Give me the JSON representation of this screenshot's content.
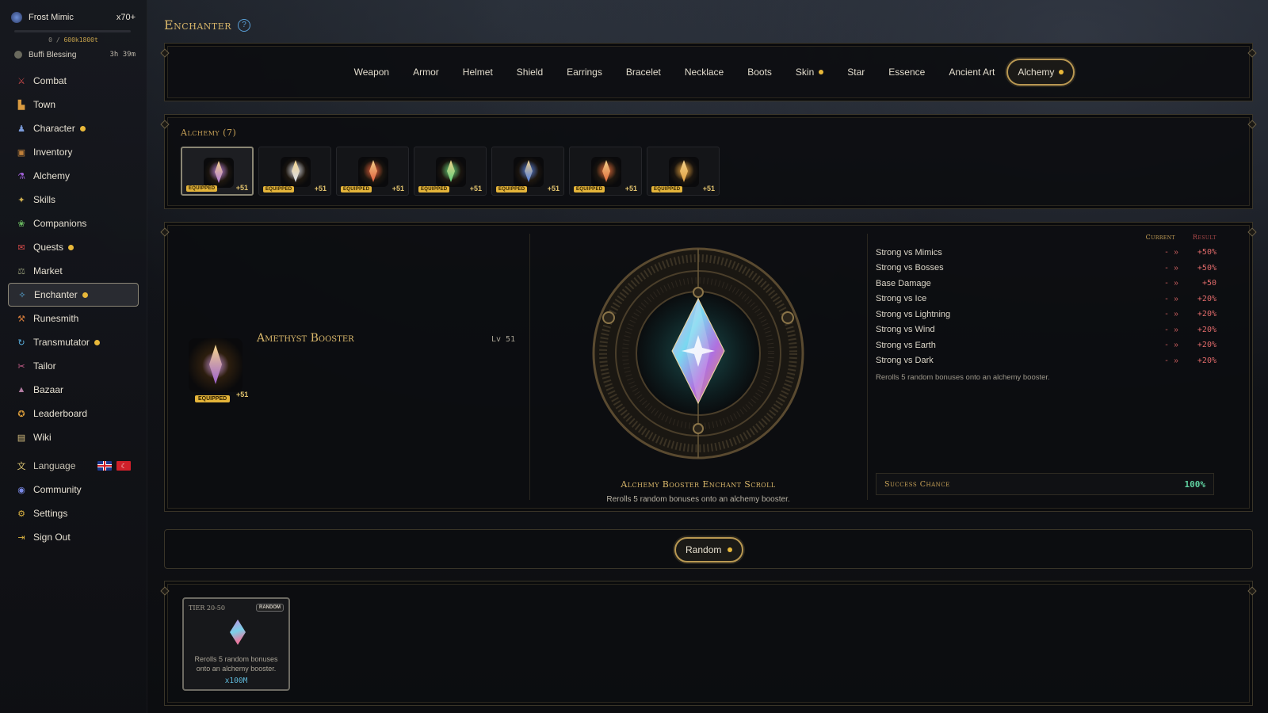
{
  "sidebar": {
    "pet": {
      "name": "Frost Mimic",
      "count": "x70+"
    },
    "xp": {
      "current": "0",
      "sep": "/",
      "max": "600k1800t"
    },
    "buff": {
      "name": "Buffi Blessing",
      "timer": "3h 39m"
    },
    "items": [
      {
        "label": "Combat",
        "icon": "crossed-swords-icon",
        "dot": false
      },
      {
        "label": "Town",
        "icon": "town-icon",
        "dot": false
      },
      {
        "label": "Character",
        "icon": "character-icon",
        "dot": true
      },
      {
        "label": "Inventory",
        "icon": "chest-icon",
        "dot": false
      },
      {
        "label": "Alchemy",
        "icon": "potion-icon",
        "dot": false
      },
      {
        "label": "Skills",
        "icon": "skills-icon",
        "dot": false
      },
      {
        "label": "Companions",
        "icon": "paw-icon",
        "dot": false
      },
      {
        "label": "Quests",
        "icon": "scroll-icon",
        "dot": true
      },
      {
        "label": "Market",
        "icon": "scales-icon",
        "dot": false
      },
      {
        "label": "Enchanter",
        "icon": "wand-icon",
        "dot": true,
        "active": true
      },
      {
        "label": "Runesmith",
        "icon": "anvil-icon",
        "dot": false
      },
      {
        "label": "Transmutator",
        "icon": "cycle-icon",
        "dot": true
      },
      {
        "label": "Tailor",
        "icon": "needle-icon",
        "dot": false
      },
      {
        "label": "Bazaar",
        "icon": "tent-icon",
        "dot": false
      },
      {
        "label": "Leaderboard",
        "icon": "trophy-icon",
        "dot": false
      },
      {
        "label": "Wiki",
        "icon": "book-icon",
        "dot": false
      }
    ],
    "language_label": "Language",
    "community_label": "Community",
    "settings_label": "Settings",
    "signout_label": "Sign Out"
  },
  "page": {
    "title": "Enchanter",
    "help_icon": "help-icon"
  },
  "tabs": [
    {
      "label": "Weapon",
      "dot": false
    },
    {
      "label": "Armor",
      "dot": false
    },
    {
      "label": "Helmet",
      "dot": false
    },
    {
      "label": "Shield",
      "dot": false
    },
    {
      "label": "Earrings",
      "dot": false
    },
    {
      "label": "Bracelet",
      "dot": false
    },
    {
      "label": "Necklace",
      "dot": false
    },
    {
      "label": "Boots",
      "dot": false
    },
    {
      "label": "Skin",
      "dot": true
    },
    {
      "label": "Star",
      "dot": false
    },
    {
      "label": "Essence",
      "dot": false
    },
    {
      "label": "Ancient Art",
      "dot": false
    },
    {
      "label": "Alchemy",
      "dot": true,
      "active": true
    }
  ],
  "alchemy": {
    "section_label": "Alchemy (7)",
    "slots": [
      {
        "badge": "EQUIPPED",
        "plus": "+51",
        "color": "#b07ad8",
        "selected": true
      },
      {
        "badge": "EQUIPPED",
        "plus": "+51",
        "color": "#d8e0f0"
      },
      {
        "badge": "EQUIPPED",
        "plus": "+51",
        "color": "#e05a3a"
      },
      {
        "badge": "EQUIPPED",
        "plus": "+51",
        "color": "#5ad07a"
      },
      {
        "badge": "EQUIPPED",
        "plus": "+51",
        "color": "#4a7ae0"
      },
      {
        "badge": "EQUIPPED",
        "plus": "+51",
        "color": "#e0683a"
      },
      {
        "badge": "EQUIPPED",
        "plus": "+51",
        "color": "#e0a040"
      }
    ]
  },
  "selected_item": {
    "name": "Amethyst Booster",
    "level": "Lv 51",
    "badge": "EQUIPPED",
    "plus": "+51"
  },
  "scroll": {
    "title": "Alchemy Booster Enchant Scroll",
    "description": "Rerolls 5 random bonuses onto an alchemy booster."
  },
  "stats": {
    "header_current": "Current",
    "header_result": "Result",
    "rows": [
      {
        "label": "Strong vs Mimics",
        "current": "-",
        "arrow": "»",
        "result": "+50%"
      },
      {
        "label": "Strong vs Bosses",
        "current": "-",
        "arrow": "»",
        "result": "+50%"
      },
      {
        "label": "Base Damage",
        "current": "-",
        "arrow": "»",
        "result": "+50"
      },
      {
        "label": "Strong vs Ice",
        "current": "-",
        "arrow": "»",
        "result": "+20%"
      },
      {
        "label": "Strong vs Lightning",
        "current": "-",
        "arrow": "»",
        "result": "+20%"
      },
      {
        "label": "Strong vs Wind",
        "current": "-",
        "arrow": "»",
        "result": "+20%"
      },
      {
        "label": "Strong vs Earth",
        "current": "-",
        "arrow": "»",
        "result": "+20%"
      },
      {
        "label": "Strong vs Dark",
        "current": "-",
        "arrow": "»",
        "result": "+20%"
      }
    ],
    "note": "Rerolls 5 random bonuses onto an alchemy booster.",
    "success_label": "Success Chance",
    "success_value": "100%"
  },
  "action": {
    "random_label": "Random"
  },
  "scroll_card": {
    "tier": "TIER 20-50",
    "badge": "RANDOM",
    "description": "Rerolls 5 random bonuses onto an alchemy booster.",
    "price": "x100M"
  },
  "colors": {
    "accent_gold": "#d8b66a",
    "notify_dot": "#e8b83a",
    "success": "#5fd0a0",
    "result_red": "#e06a6a"
  }
}
